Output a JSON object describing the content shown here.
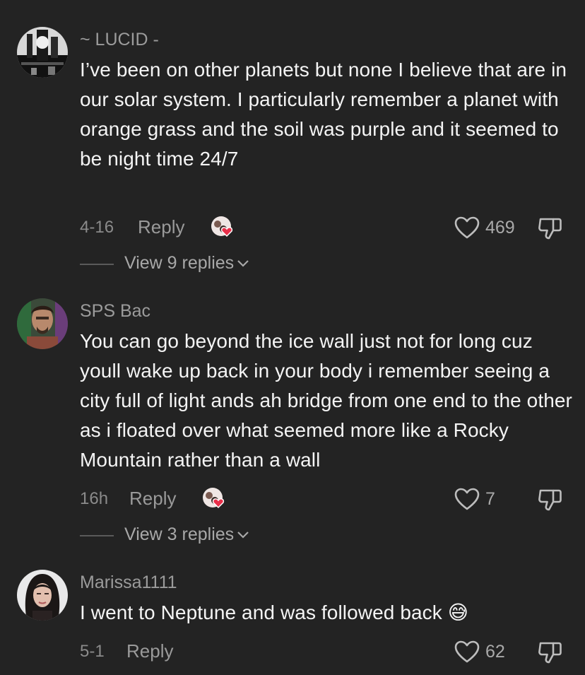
{
  "top_partial_text": "",
  "comments": [
    {
      "username": "~ LUCID -",
      "text": "I’ve been on other planets but none I believe that are in our solar system. I particularly remember a planet with orange grass and the soil was purple and it seemed to be night time 24/7",
      "date": "4-16",
      "reply_label": "Reply",
      "likes": "469",
      "replies_label": "View 9 replies"
    },
    {
      "username": "SPS Bac",
      "text": "You can go beyond the ice wall just not for long cuz youll wake up back in your body i remember seeing a city full of light ands ah bridge from one end to the other as i floated over what seemed more like a Rocky Mountain rather than a wall",
      "date": "16h",
      "reply_label": "Reply",
      "likes": "7",
      "replies_label": "View 3 replies"
    },
    {
      "username": "Marissa1111",
      "text": "I went to Neptune and was followed back 😅",
      "date": "5-1",
      "reply_label": "Reply",
      "likes": "62"
    }
  ],
  "icons": {
    "like": "heart-outline-icon",
    "dislike": "thumbs-down-icon",
    "creator_liked": "creator-liked-icon",
    "chevron": "chevron-down-icon"
  },
  "colors": {
    "background": "#232323",
    "heart_badge": "#e8304a"
  }
}
